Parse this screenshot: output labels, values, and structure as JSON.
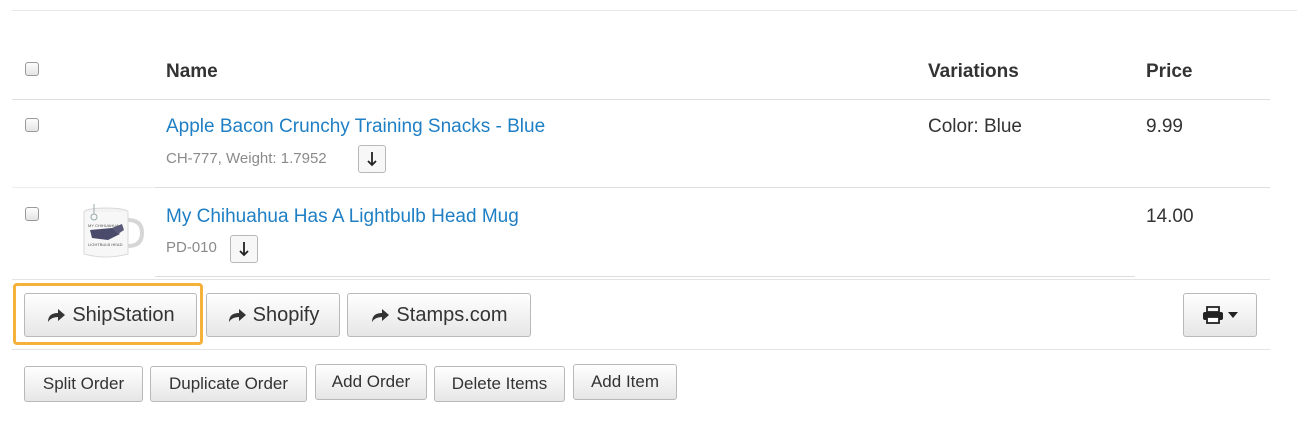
{
  "table": {
    "headers": {
      "name": "Name",
      "variations": "Variations",
      "price": "Price"
    },
    "rows": [
      {
        "name": "Apple Bacon Crunchy Training Snacks - Blue",
        "meta": "CH-777, Weight: 1.7952",
        "variation": "Color: Blue",
        "price": "9.99",
        "icon": "down-arrow-icon"
      },
      {
        "name": "My Chihuahua Has A Lightbulb Head Mug",
        "meta": "PD-010",
        "variation": "",
        "price": "14.00",
        "icon": "down-arrow-icon",
        "thumbnail": "mug-thumbnail"
      }
    ]
  },
  "integrations": [
    {
      "label": "ShipStation",
      "icon": "share-arrow-icon",
      "highlighted": true
    },
    {
      "label": "Shopify",
      "icon": "share-arrow-icon"
    },
    {
      "label": "Stamps.com",
      "icon": "share-arrow-icon"
    }
  ],
  "print_menu": {
    "icon": "printer-icon",
    "caret": "caret-down-icon"
  },
  "actions": [
    "Split Order",
    "Duplicate Order",
    "Add Order",
    "Delete Items",
    "Add Item"
  ],
  "colors": {
    "link": "#1f7fc4",
    "highlight": "#f6b13b"
  }
}
